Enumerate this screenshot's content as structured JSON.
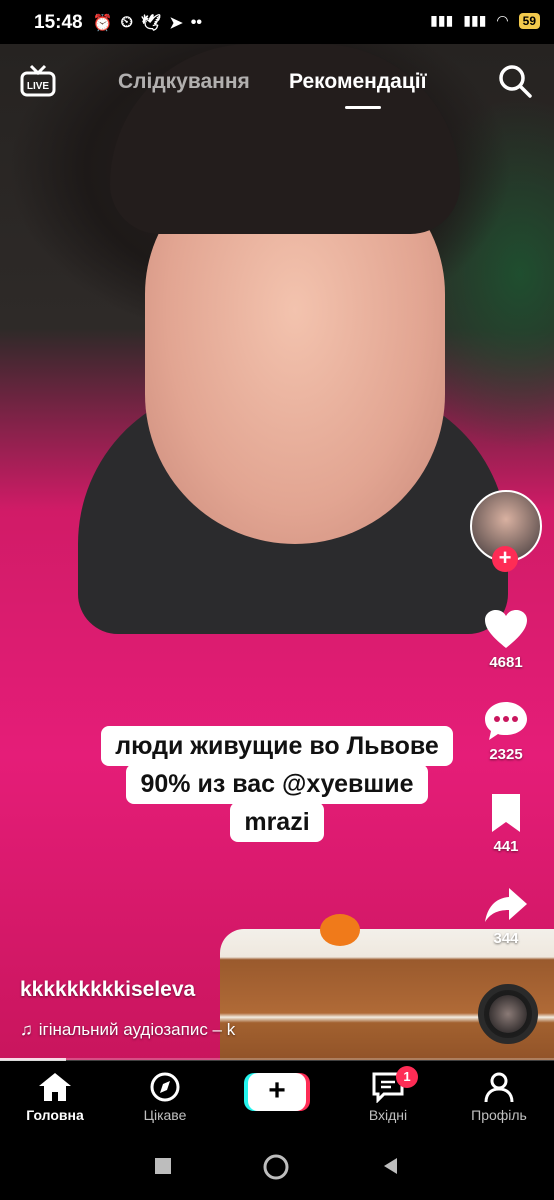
{
  "status_bar": {
    "time": "15:48",
    "battery": "59"
  },
  "top_nav": {
    "tab_following": "Слідкування",
    "tab_for_you": "Рекомендації",
    "live_label": "LIVE"
  },
  "video": {
    "caption_lines": [
      "люди живущие во Львове",
      "90% из вас @хуевшие",
      "mrazi"
    ],
    "author": "kkkkkkkkkiseleva",
    "audio": "ігінальний аудіозапис – k",
    "progress": 0.12
  },
  "actions": {
    "likes": "4681",
    "comments": "2325",
    "saves": "441",
    "shares": "344"
  },
  "bottom_nav": {
    "home": "Головна",
    "discover": "Цікаве",
    "inbox": "Вхідні",
    "inbox_badge": "1",
    "profile": "Профіль"
  },
  "colors": {
    "accent": "#fe2c55",
    "cyan": "#25f4ee",
    "jacket": "#e51d78"
  }
}
